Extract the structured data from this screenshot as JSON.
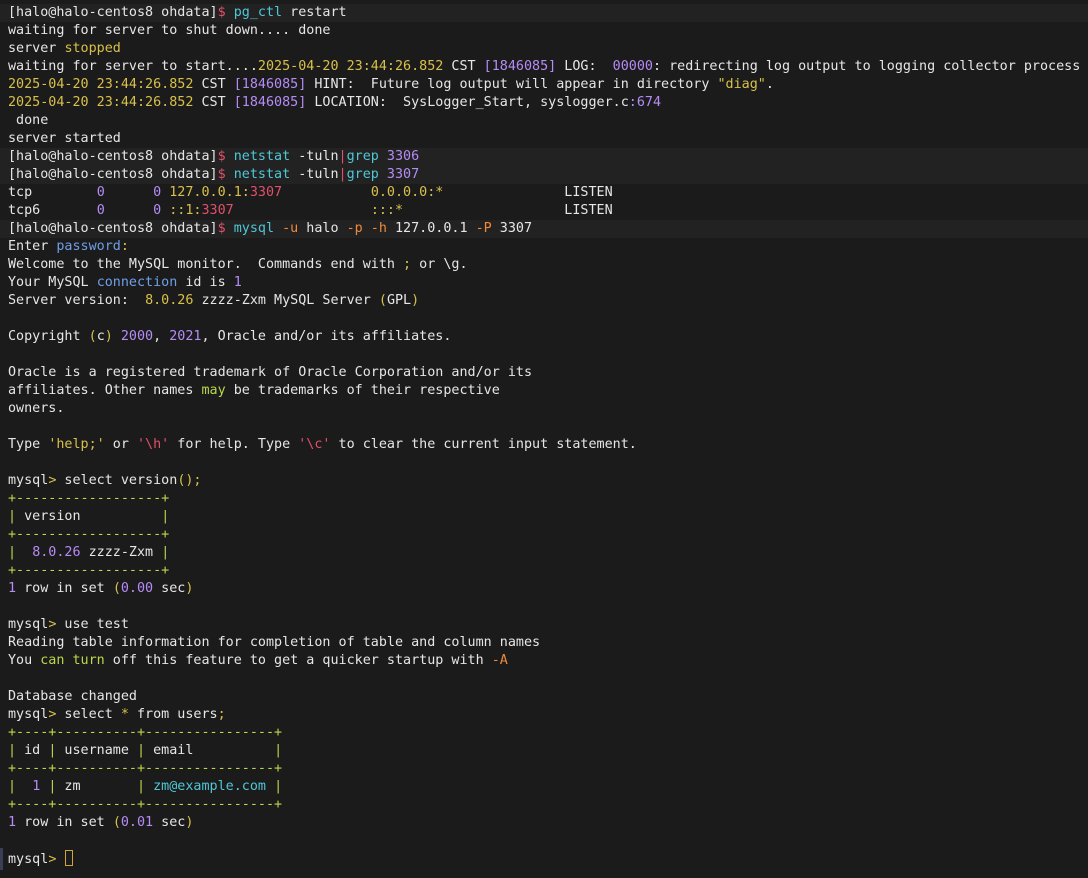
{
  "window": {
    "caret_color": "#d8a23a"
  },
  "colors": {
    "background": "#1b1b1b",
    "text": "#e6e6e6",
    "red": "#e0506a",
    "teal": "#4fc7d6",
    "purple": "#b58cf5",
    "yellow": "#d8c04a",
    "green": "#b9d84a",
    "orange": "#f08a3a"
  },
  "lines": [
    {
      "prompt": true,
      "segments": [
        {
          "t": "[halo@halo-centos8 ohdata]"
        },
        {
          "t": "$ ",
          "c": "red"
        },
        {
          "t": "pg_ctl",
          "c": "teal"
        },
        {
          "t": " restart"
        }
      ]
    },
    {
      "segments": [
        {
          "t": "waiting for server to shut down.... done"
        }
      ]
    },
    {
      "segments": [
        {
          "t": "server "
        },
        {
          "t": "stopped",
          "c": "yellow"
        }
      ]
    },
    {
      "segments": [
        {
          "t": "waiting for server to start...."
        },
        {
          "t": "2025-04-20 23:44:26.852",
          "c": "yellow"
        },
        {
          "t": " CST "
        },
        {
          "t": "[1846085]",
          "c": "purple"
        },
        {
          "t": " LOG:  "
        },
        {
          "t": "00000",
          "c": "purple"
        },
        {
          "t": ": redirecting log output to logging collector process"
        }
      ]
    },
    {
      "segments": [
        {
          "t": "2025-04-20 23:44:26.852",
          "c": "yellow"
        },
        {
          "t": " CST "
        },
        {
          "t": "[1846085]",
          "c": "purple"
        },
        {
          "t": " HINT:  Future log output will appear in directory "
        },
        {
          "t": "\"diag\"",
          "c": "yellow"
        },
        {
          "t": "."
        }
      ]
    },
    {
      "segments": [
        {
          "t": "2025-04-20 23:44:26.852",
          "c": "yellow"
        },
        {
          "t": " CST "
        },
        {
          "t": "[1846085]",
          "c": "purple"
        },
        {
          "t": " LOCATION:  SysLogger_Start, syslogger.c"
        },
        {
          "t": ":674",
          "c": "purple"
        }
      ]
    },
    {
      "segments": [
        {
          "t": " done"
        }
      ]
    },
    {
      "segments": [
        {
          "t": "server started"
        }
      ]
    },
    {
      "prompt": true,
      "segments": [
        {
          "t": "[halo@halo-centos8 ohdata]"
        },
        {
          "t": "$ ",
          "c": "red"
        },
        {
          "t": "netstat",
          "c": "teal"
        },
        {
          "t": " -tuln"
        },
        {
          "t": "|",
          "c": "red"
        },
        {
          "t": "grep",
          "c": "teal"
        },
        {
          "t": " "
        },
        {
          "t": "3306",
          "c": "purple"
        }
      ]
    },
    {
      "prompt": true,
      "segments": [
        {
          "t": "[halo@halo-centos8 ohdata]"
        },
        {
          "t": "$ ",
          "c": "red"
        },
        {
          "t": "netstat",
          "c": "teal"
        },
        {
          "t": " -tuln"
        },
        {
          "t": "|",
          "c": "red"
        },
        {
          "t": "grep",
          "c": "teal"
        },
        {
          "t": " "
        },
        {
          "t": "3307",
          "c": "purple"
        }
      ]
    },
    {
      "segments": [
        {
          "t": "tcp        "
        },
        {
          "t": "0",
          "c": "purple"
        },
        {
          "t": "      "
        },
        {
          "t": "0",
          "c": "purple"
        },
        {
          "t": " "
        },
        {
          "t": "127.0.0.1:",
          "c": "yellow"
        },
        {
          "t": "3307",
          "c": "red"
        },
        {
          "t": "           "
        },
        {
          "t": "0.0.0.0:*",
          "c": "yellow"
        },
        {
          "t": "               LISTEN"
        }
      ]
    },
    {
      "segments": [
        {
          "t": "tcp6       "
        },
        {
          "t": "0",
          "c": "purple"
        },
        {
          "t": "      "
        },
        {
          "t": "0",
          "c": "purple"
        },
        {
          "t": " "
        },
        {
          "t": "::1:",
          "c": "yellow"
        },
        {
          "t": "3307",
          "c": "red"
        },
        {
          "t": "                 "
        },
        {
          "t": ":::*",
          "c": "yellow"
        },
        {
          "t": "                    LISTEN"
        }
      ]
    },
    {
      "prompt": true,
      "segments": [
        {
          "t": "[halo@halo-centos8 ohdata]"
        },
        {
          "t": "$ ",
          "c": "red"
        },
        {
          "t": "mysql",
          "c": "teal"
        },
        {
          "t": " "
        },
        {
          "t": "-u",
          "c": "orange"
        },
        {
          "t": " halo "
        },
        {
          "t": "-p",
          "c": "orange"
        },
        {
          "t": " "
        },
        {
          "t": "-h",
          "c": "orange"
        },
        {
          "t": " 127.0.0.1 "
        },
        {
          "t": "-P",
          "c": "orange"
        },
        {
          "t": " 3307"
        }
      ]
    },
    {
      "segments": [
        {
          "t": "Enter "
        },
        {
          "t": "password",
          "c": "blue"
        },
        {
          "t": ":",
          "c": "yellow"
        }
      ]
    },
    {
      "segments": [
        {
          "t": "Welcome to the MySQL monitor.  Commands end with "
        },
        {
          "t": ";",
          "c": "yellow"
        },
        {
          "t": " or \\g."
        }
      ]
    },
    {
      "segments": [
        {
          "t": "Your MySQL "
        },
        {
          "t": "connection",
          "c": "blue"
        },
        {
          "t": " id is "
        },
        {
          "t": "1",
          "c": "purple"
        }
      ]
    },
    {
      "segments": [
        {
          "t": "Server version:  "
        },
        {
          "t": "8.0.26",
          "c": "yellow"
        },
        {
          "t": " zzzz-Zxm MySQL Server "
        },
        {
          "t": "(",
          "c": "yellow"
        },
        {
          "t": "GPL"
        },
        {
          "t": ")",
          "c": "yellow"
        }
      ]
    },
    {
      "segments": [
        {
          "t": ""
        }
      ]
    },
    {
      "segments": [
        {
          "t": "Copyright "
        },
        {
          "t": "(",
          "c": "yellow"
        },
        {
          "t": "c"
        },
        {
          "t": ")",
          "c": "yellow"
        },
        {
          "t": " "
        },
        {
          "t": "2000",
          "c": "purple"
        },
        {
          "t": ", "
        },
        {
          "t": "2021",
          "c": "purple"
        },
        {
          "t": ", Oracle and/or its affiliates."
        }
      ]
    },
    {
      "segments": [
        {
          "t": ""
        }
      ]
    },
    {
      "segments": [
        {
          "t": "Oracle is a registered trademark of Oracle Corporation and/or its"
        }
      ]
    },
    {
      "segments": [
        {
          "t": "affiliates. Other names "
        },
        {
          "t": "may",
          "c": "green"
        },
        {
          "t": " be trademarks of their respective"
        }
      ]
    },
    {
      "segments": [
        {
          "t": "owners."
        }
      ]
    },
    {
      "segments": [
        {
          "t": ""
        }
      ]
    },
    {
      "segments": [
        {
          "t": "Type "
        },
        {
          "t": "'help;'",
          "c": "yellow"
        },
        {
          "t": " or "
        },
        {
          "t": "'\\h'",
          "c": "red"
        },
        {
          "t": " for help. Type "
        },
        {
          "t": "'\\c'",
          "c": "red"
        },
        {
          "t": " to clear the current input statement."
        }
      ]
    },
    {
      "segments": [
        {
          "t": ""
        }
      ]
    },
    {
      "segments": [
        {
          "t": "mysql"
        },
        {
          "t": ">",
          "c": "yellow"
        },
        {
          "t": " select version"
        },
        {
          "t": "();",
          "c": "yellow"
        }
      ]
    },
    {
      "segments": [
        {
          "t": "+------------------+",
          "c": "green"
        }
      ]
    },
    {
      "segments": [
        {
          "t": "|",
          "c": "green"
        },
        {
          "t": " version          "
        },
        {
          "t": "|",
          "c": "green"
        }
      ]
    },
    {
      "segments": [
        {
          "t": "+------------------+",
          "c": "green"
        }
      ]
    },
    {
      "segments": [
        {
          "t": "|",
          "c": "green"
        },
        {
          "t": "  "
        },
        {
          "t": "8.0.26",
          "c": "purple"
        },
        {
          "t": " zzzz-Zxm "
        },
        {
          "t": "|",
          "c": "green"
        }
      ]
    },
    {
      "segments": [
        {
          "t": "+------------------+",
          "c": "green"
        }
      ]
    },
    {
      "segments": [
        {
          "t": "1",
          "c": "purple"
        },
        {
          "t": " row in set "
        },
        {
          "t": "(",
          "c": "yellow"
        },
        {
          "t": "0.00",
          "c": "purple"
        },
        {
          "t": " sec"
        },
        {
          "t": ")",
          "c": "yellow"
        }
      ]
    },
    {
      "segments": [
        {
          "t": ""
        }
      ]
    },
    {
      "segments": [
        {
          "t": "mysql"
        },
        {
          "t": ">",
          "c": "yellow"
        },
        {
          "t": " use test"
        }
      ]
    },
    {
      "segments": [
        {
          "t": "Reading table information for completion of table and column names"
        }
      ]
    },
    {
      "segments": [
        {
          "t": "You "
        },
        {
          "t": "can",
          "c": "green"
        },
        {
          "t": " "
        },
        {
          "t": "turn",
          "c": "green"
        },
        {
          "t": " off this feature to get a quicker startup with "
        },
        {
          "t": "-A",
          "c": "orange"
        }
      ]
    },
    {
      "segments": [
        {
          "t": ""
        }
      ]
    },
    {
      "segments": [
        {
          "t": "Database changed"
        }
      ]
    },
    {
      "segments": [
        {
          "t": "mysql"
        },
        {
          "t": ">",
          "c": "yellow"
        },
        {
          "t": " select "
        },
        {
          "t": "*",
          "c": "yellow"
        },
        {
          "t": " from users"
        },
        {
          "t": ";",
          "c": "yellow"
        }
      ]
    },
    {
      "segments": [
        {
          "t": "+----+----------+----------------+",
          "c": "green"
        }
      ]
    },
    {
      "segments": [
        {
          "t": "|",
          "c": "green"
        },
        {
          "t": " id "
        },
        {
          "t": "|",
          "c": "green"
        },
        {
          "t": " username "
        },
        {
          "t": "|",
          "c": "green"
        },
        {
          "t": " email          "
        },
        {
          "t": "|",
          "c": "green"
        }
      ]
    },
    {
      "segments": [
        {
          "t": "+----+----------+----------------+",
          "c": "green"
        }
      ]
    },
    {
      "segments": [
        {
          "t": "|",
          "c": "green"
        },
        {
          "t": "  "
        },
        {
          "t": "1",
          "c": "purple"
        },
        {
          "t": " "
        },
        {
          "t": "|",
          "c": "green"
        },
        {
          "t": " zm       "
        },
        {
          "t": "|",
          "c": "green"
        },
        {
          "t": " "
        },
        {
          "t": "zm@example.com",
          "c": "teal"
        },
        {
          "t": " "
        },
        {
          "t": "|",
          "c": "green"
        }
      ]
    },
    {
      "segments": [
        {
          "t": "+----+----------+----------------+",
          "c": "green"
        }
      ]
    },
    {
      "segments": [
        {
          "t": "1",
          "c": "purple"
        },
        {
          "t": " row in set "
        },
        {
          "t": "(",
          "c": "yellow"
        },
        {
          "t": "0.01",
          "c": "purple"
        },
        {
          "t": " sec"
        },
        {
          "t": ")",
          "c": "yellow"
        }
      ]
    },
    {
      "segments": [
        {
          "t": ""
        }
      ]
    },
    {
      "current": true,
      "segments": [
        {
          "t": "mysql"
        },
        {
          "t": ">",
          "c": "yellow"
        },
        {
          "t": " "
        }
      ]
    }
  ]
}
